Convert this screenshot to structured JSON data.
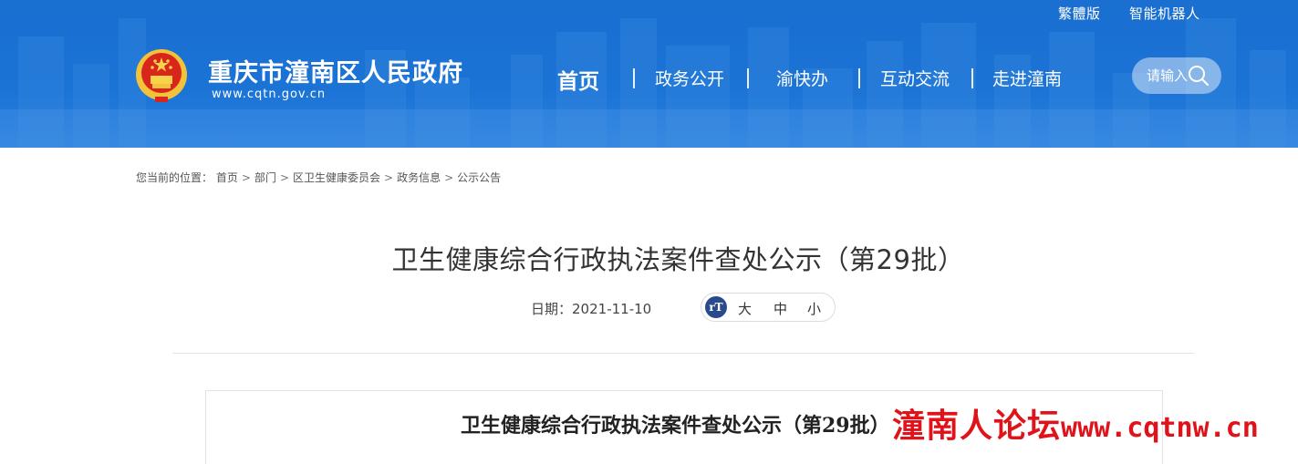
{
  "header": {
    "top_links": [
      "繁體版",
      "智能机器人"
    ],
    "site_title": "重庆市潼南区人民政府",
    "site_url": "www.cqtn.gov.cn",
    "nav": [
      "首页",
      "政务公开",
      "渝快办",
      "互动交流",
      "走进潼南"
    ],
    "search_placeholder": "请输入"
  },
  "breadcrumb": {
    "prefix": "您当前的位置：",
    "items": [
      "首页",
      "部门",
      "区卫生健康委员会",
      "政务信息",
      "公示公告"
    ],
    "separator": ">"
  },
  "article": {
    "title": "卫生健康综合行政执法案件查处公示（第29批）",
    "date_label": "日期：",
    "date": "2021-11-10",
    "font_icon": "rT",
    "font_sizes": [
      "大",
      "中",
      "小"
    ],
    "doc_title": "卫生健康综合行政执法案件查处公示（第29批）"
  },
  "watermark": {
    "cn": "潼南人论坛",
    "url": "www.cqtnw.cn"
  },
  "colors": {
    "header_blue": "#1b73d6",
    "font_icon_bg": "#2a4a8e",
    "watermark_red": "#e0131a"
  }
}
